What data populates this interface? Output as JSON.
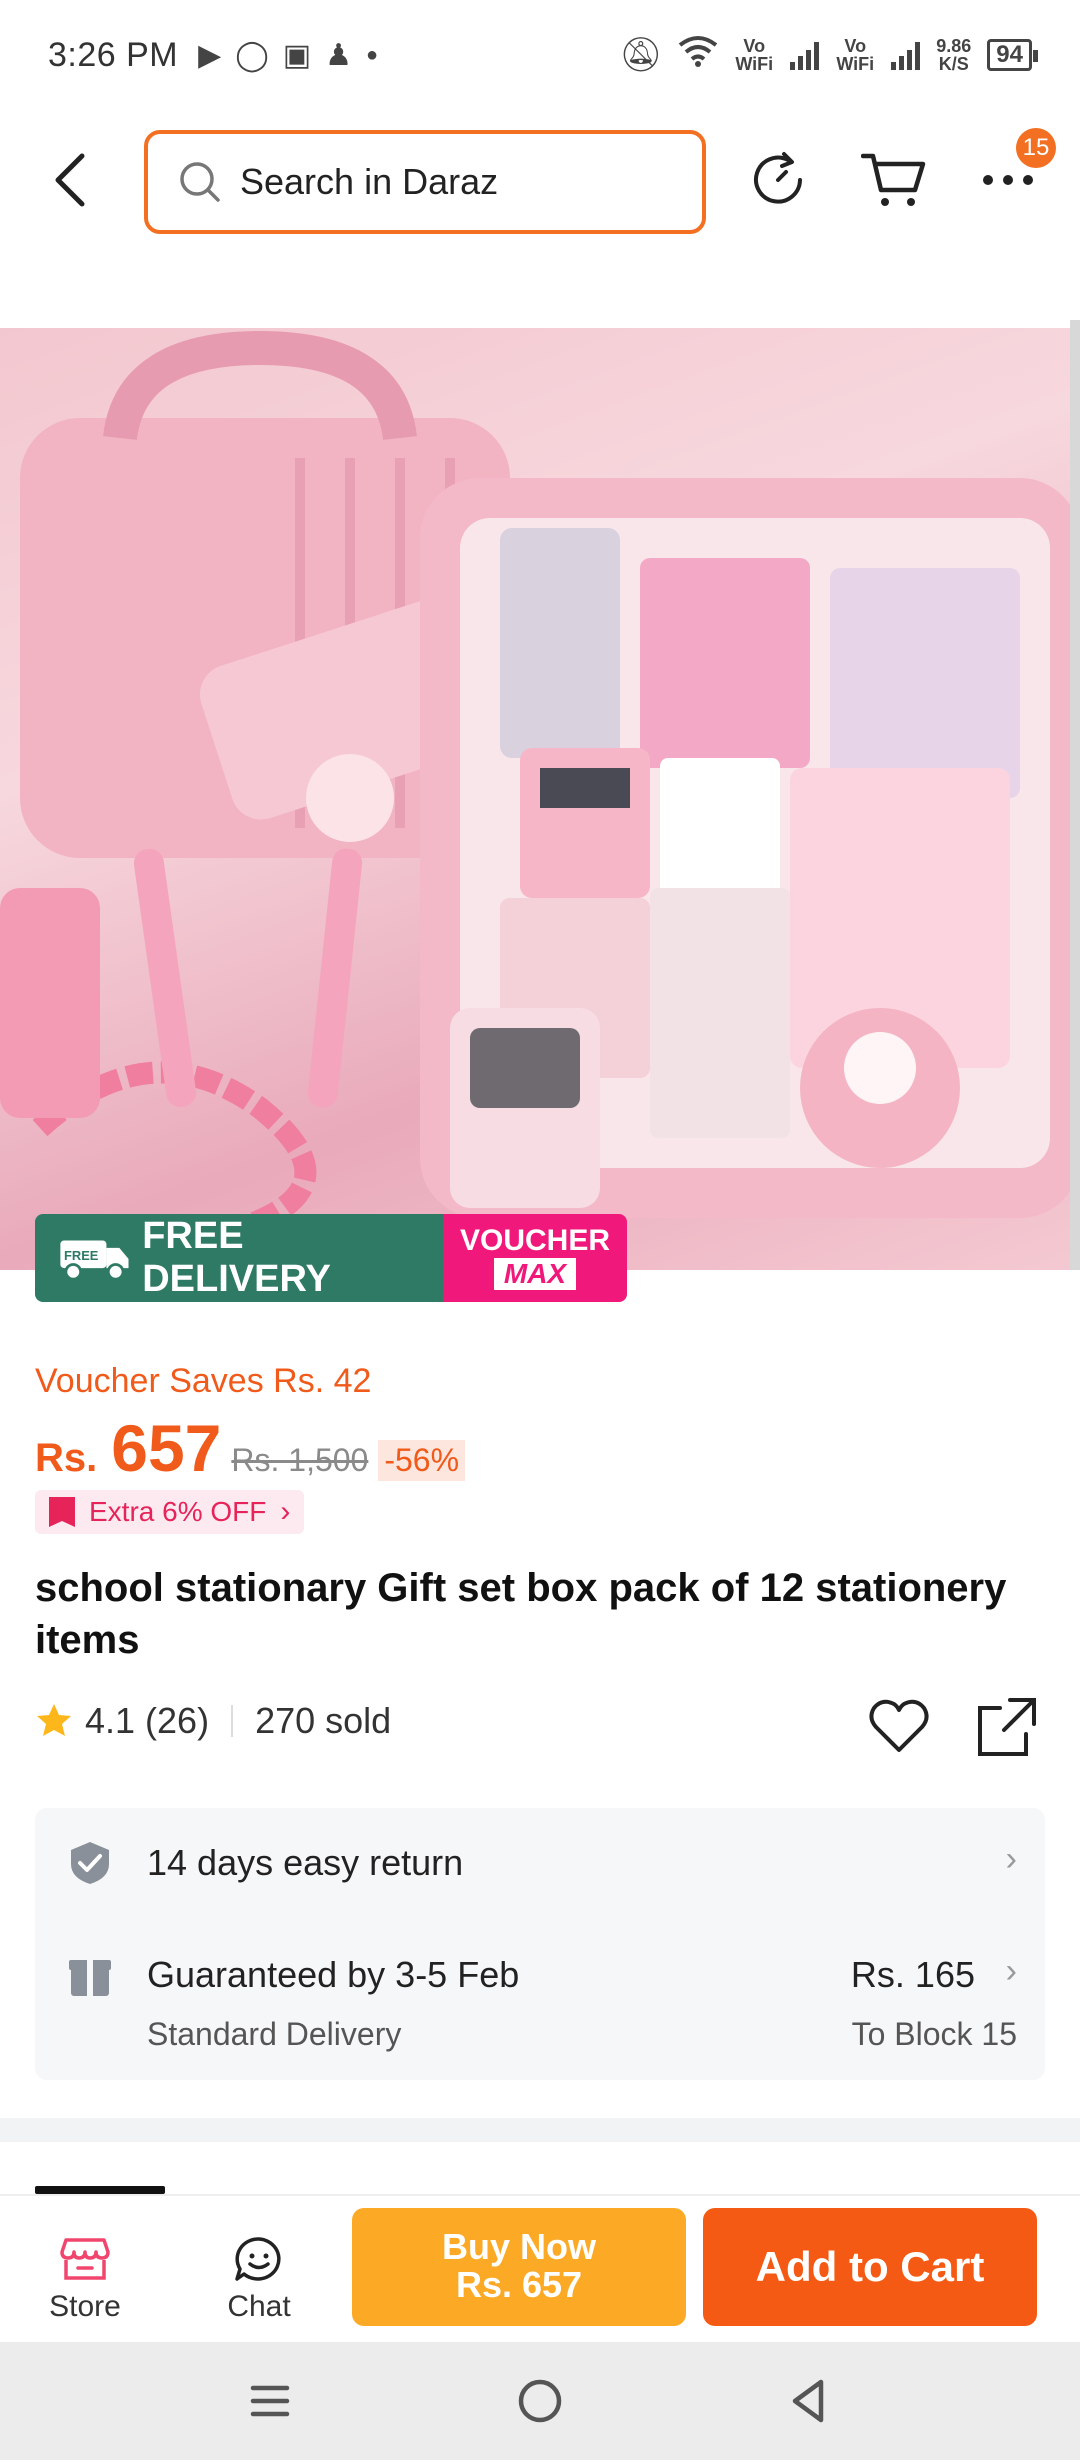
{
  "status_bar": {
    "time": "3:26 PM",
    "vo_wifi_1": "Vo WiFi",
    "vo_wifi_2": "Vo WiFi",
    "speed_value": "9.86",
    "speed_unit": "K/S",
    "battery": "94"
  },
  "header": {
    "search_placeholder": "Search in Daraz",
    "cart_badge": "15"
  },
  "promo": {
    "free_delivery": "FREE DELIVERY",
    "free_label": "FREE",
    "voucher_line1": "VOUCHER",
    "voucher_line2": "MAX"
  },
  "price": {
    "voucher_saves": "Voucher Saves Rs. 42",
    "currency": "Rs.",
    "value": "657",
    "original": "Rs. 1,500",
    "discount": "-56%",
    "extra_off": "Extra 6% OFF"
  },
  "product": {
    "title": "school stationary Gift set box pack of 12 stationery items",
    "rating": "4.1 (26)",
    "sold": "270 sold"
  },
  "services": {
    "return_text": "14 days easy return",
    "delivery_text": "Guaranteed by 3-5 Feb",
    "delivery_type": "Standard Delivery",
    "delivery_fee": "Rs. 165",
    "delivery_location": "To Block 15"
  },
  "bottom_bar": {
    "store_label": "Store",
    "chat_label": "Chat",
    "buy_now_line1": "Buy Now",
    "buy_now_line2": "Rs. 657",
    "add_to_cart": "Add to Cart"
  },
  "colors": {
    "accent_orange": "#f55a14",
    "buy_now_yellow": "#fcaa26",
    "free_delivery_green": "#2f7a64",
    "voucher_pink": "#f0187a"
  }
}
